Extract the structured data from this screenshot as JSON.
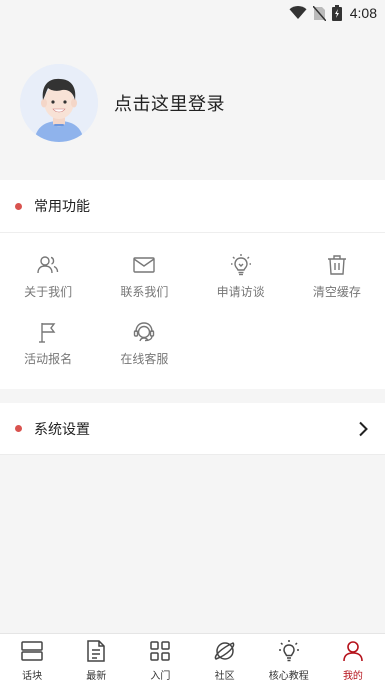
{
  "status": {
    "time": "4:08"
  },
  "profile": {
    "login_text": "点击这里登录"
  },
  "functions": {
    "title": "常用功能",
    "items": [
      {
        "label": "关于我们",
        "icon": "users-icon"
      },
      {
        "label": "联系我们",
        "icon": "mail-icon"
      },
      {
        "label": "申请访谈",
        "icon": "lightbulb-icon"
      },
      {
        "label": "清空缓存",
        "icon": "trash-icon"
      },
      {
        "label": "活动报名",
        "icon": "flag-icon"
      },
      {
        "label": "在线客服",
        "icon": "headset-icon"
      }
    ]
  },
  "settings": {
    "title": "系统设置"
  },
  "tabs": [
    {
      "label": "话块",
      "icon": "blocks-icon"
    },
    {
      "label": "最新",
      "icon": "document-icon"
    },
    {
      "label": "入门",
      "icon": "grid-icon"
    },
    {
      "label": "社区",
      "icon": "planet-icon"
    },
    {
      "label": "核心教程",
      "icon": "bulb-icon"
    },
    {
      "label": "我的",
      "icon": "person-icon",
      "active": true
    }
  ],
  "colors": {
    "accent": "#b5121b",
    "dot": "#d9534f"
  }
}
